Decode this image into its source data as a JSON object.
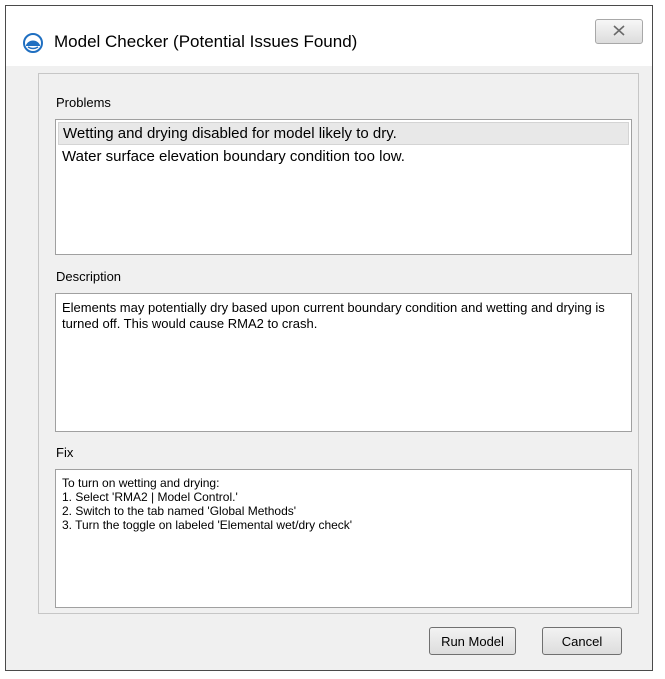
{
  "window": {
    "title": "Model Checker (Potential Issues Found)",
    "icon": "globe-water-icon",
    "close_icon": "close-icon"
  },
  "problems": {
    "label": "Problems",
    "items": [
      {
        "text": "Wetting and drying disabled for model likely to dry.",
        "selected": true
      },
      {
        "text": "Water surface elevation boundary condition too low.",
        "selected": false
      }
    ]
  },
  "description": {
    "label": "Description",
    "text": "Elements may potentially dry based upon current boundary condition and wetting and drying is turned off.  This would cause RMA2 to crash."
  },
  "fix": {
    "label": "Fix",
    "lines": [
      "To turn on wetting and drying:",
      "1. Select 'RMA2 | Model Control.'",
      "2. Switch to the tab named 'Global Methods'",
      "3. Turn the toggle on labeled 'Elemental wet/dry check'"
    ]
  },
  "buttons": {
    "run_model": "Run Model",
    "cancel": "Cancel"
  },
  "colors": {
    "dialog_bg": "#f0f0f0",
    "icon_blue": "#1f6fc1",
    "selection_bg": "#e8e8e8"
  }
}
